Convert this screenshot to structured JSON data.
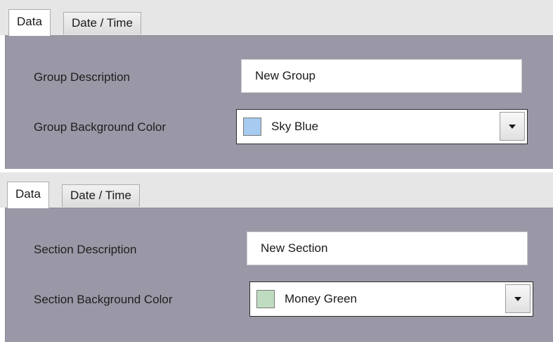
{
  "panels": [
    {
      "tabs": [
        "Data",
        "Date / Time"
      ],
      "active_tab": "Data",
      "description_label": "Group Description",
      "description_value": "New Group",
      "color_label": "Group Background Color",
      "color_name": "Sky Blue",
      "color_hex": "#a6caf0"
    },
    {
      "tabs": [
        "Data",
        "Date / Time"
      ],
      "active_tab": "Data",
      "description_label": "Section Description",
      "description_value": "New Section",
      "color_label": "Section Background Color",
      "color_name": "Money Green",
      "color_hex": "#c0dcc0"
    }
  ],
  "colors": {
    "content_background": "#9a98a6",
    "tabstrip_background": "#e6e6e6"
  }
}
